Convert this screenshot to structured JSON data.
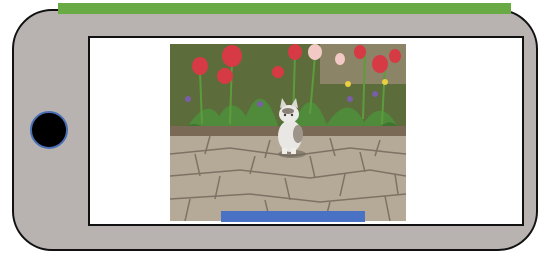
{
  "device": {
    "orientation": "landscape",
    "body_color": "#b8b3b1",
    "outline_color": "#111111",
    "top_bar_color": "#6aaa44",
    "home_button_color": "#000000",
    "home_button_ring_color": "#4a6fb5"
  },
  "screen": {
    "background": "#ffffff",
    "image": {
      "subject": "cat-among-tulips-photo",
      "icon": "photo-icon"
    },
    "overlay_bar_color": "#4a72c4"
  }
}
